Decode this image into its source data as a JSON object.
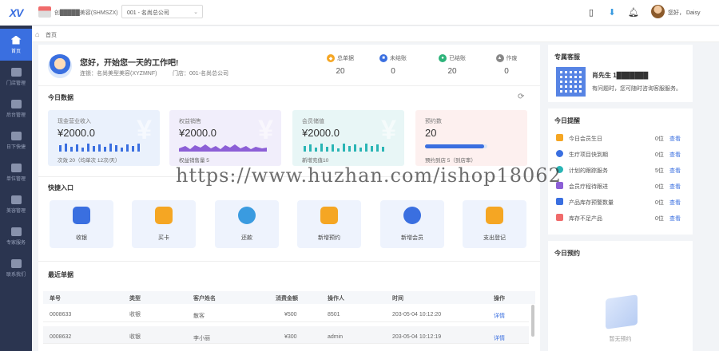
{
  "header": {
    "store_name": "创█████美容(SHMSZX)",
    "branch": "001 - 名尚总公司",
    "user_greeting": "您好， Daisy"
  },
  "nav": [
    {
      "label": "首页",
      "active": true
    },
    {
      "label": "门店管理"
    },
    {
      "label": "后台管理"
    },
    {
      "label": "日下快捷"
    },
    {
      "label": "单位管理"
    },
    {
      "label": "美容管理"
    },
    {
      "label": "专家服务"
    },
    {
      "label": "联系我们"
    }
  ],
  "breadcrumb": "首页",
  "welcome": {
    "title": "您好，开始您一天的工作吧!",
    "company": "连锁：名尚美型美容(XYZMNF)",
    "store": "门店：001-名尚总公司"
  },
  "stats": [
    {
      "label": "总单据",
      "value": "20",
      "color": "#f5a623",
      "glyph": "◆"
    },
    {
      "label": "未结账",
      "value": "0",
      "color": "#3a6fe0",
      "glyph": "■"
    },
    {
      "label": "已结账",
      "value": "20",
      "color": "#2db37a",
      "glyph": "●"
    },
    {
      "label": "作废",
      "value": "0",
      "color": "#888888",
      "glyph": "▲"
    }
  ],
  "today": {
    "title": "今日数据",
    "cards": [
      {
        "label": "现金营业收入",
        "value": "¥2000.0",
        "foot": "次效 20（均单次 12次/天）",
        "bg": "#eaf1fc",
        "chart": "bars",
        "color": "#3a6fe0"
      },
      {
        "label": "权益销售",
        "value": "¥2000.0",
        "foot": "权益销售量 5",
        "bg": "#f1eefb",
        "chart": "area",
        "color": "#8c5fd6"
      },
      {
        "label": "会员储值",
        "value": "¥2000.0",
        "foot": "新增充值10",
        "bg": "#e8f6f6",
        "chart": "bars",
        "color": "#2ab5b5"
      },
      {
        "label": "预约数",
        "value": "20",
        "foot": "预约到店 5（到店率）",
        "bg": "#fdf0ef",
        "chart": "progress",
        "color": "#3a6fe0",
        "progress": 0.95
      }
    ]
  },
  "quick": {
    "title": "快捷入口",
    "items": [
      {
        "label": "收银",
        "color": "#3a6fe0"
      },
      {
        "label": "买卡",
        "color": "#f5a623"
      },
      {
        "label": "还款",
        "color": "#3a9be0"
      },
      {
        "label": "新增预约",
        "color": "#f5a623"
      },
      {
        "label": "新增会员",
        "color": "#3a6fe0"
      },
      {
        "label": "支出登记",
        "color": "#f5a623"
      }
    ]
  },
  "recent": {
    "title": "最近单据",
    "columns": [
      "单号",
      "类型",
      "客户姓名",
      "消费金额",
      "操作人",
      "时间",
      "操作"
    ],
    "rows": [
      {
        "id": "0008633",
        "type": "收银",
        "customer": "散客",
        "amount": "¥500",
        "operator": "8501",
        "time": "203-05-04 10:12:20",
        "action": "详情"
      },
      {
        "id": "0008632",
        "type": "收银",
        "customer": "李小丽",
        "amount": "¥300",
        "operator": "admin",
        "time": "203-05-04 10:12:19",
        "action": "详情"
      }
    ]
  },
  "service": {
    "title": "专属客服",
    "name": "肖先生 1███████",
    "note": "有问题时，您可随时咨询客服服务。"
  },
  "reminders": {
    "title": "今日提醒",
    "items": [
      {
        "label": "今日会员生日",
        "count": "0位",
        "link": "查看",
        "color": "#f5a623"
      },
      {
        "label": "生疗项目快到期",
        "count": "0位",
        "link": "查看",
        "color": "#3a6fe0"
      },
      {
        "label": "计划的跟踪服务",
        "count": "5位",
        "link": "查看",
        "color": "#2ab5b5"
      },
      {
        "label": "会员疗程待跟进",
        "count": "0位",
        "link": "查看",
        "color": "#8c5fd6"
      },
      {
        "label": "产品库存预警数量",
        "count": "0位",
        "link": "查看",
        "color": "#3a6fe0"
      },
      {
        "label": "库存不足产品",
        "count": "0位",
        "link": "查看",
        "color": "#f06b6b"
      }
    ]
  },
  "appointments": {
    "title": "今日预约",
    "empty": "暂无预约"
  },
  "watermark": "https://www.huzhan.com/ishop18062"
}
